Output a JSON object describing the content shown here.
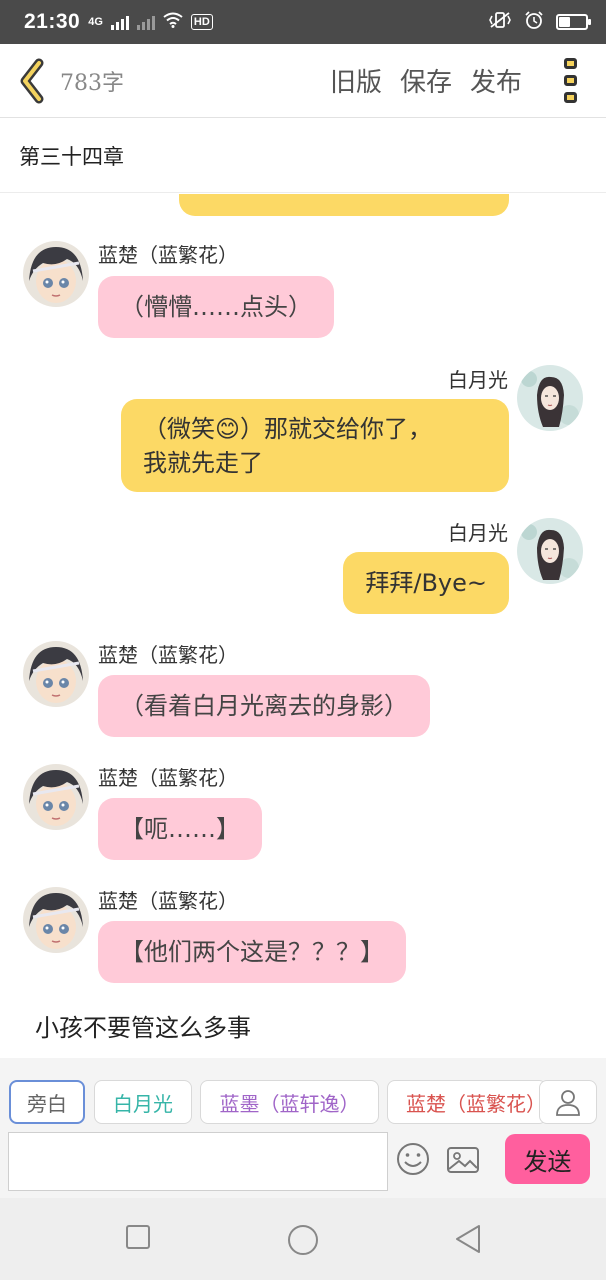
{
  "status": {
    "time": "21:30",
    "network": "4G",
    "hd": "HD"
  },
  "toolbar": {
    "word_count": "783字",
    "old_version": "旧版",
    "save": "保存",
    "publish": "发布"
  },
  "chapter": {
    "title": "第三十四章"
  },
  "messages": [
    {
      "speaker": "蓝楚（蓝繁花）",
      "text": "（懵懵……点头）"
    },
    {
      "speaker": "白月光",
      "text_line1": "（微笑😊）那就交给你了，",
      "text_line2": "我就先走了"
    },
    {
      "speaker": "白月光",
      "text": "拜拜/Bye~"
    },
    {
      "speaker": "蓝楚（蓝繁花）",
      "text": "（看着白月光离去的身影）"
    },
    {
      "speaker": "蓝楚（蓝繁花）",
      "text": "【呃……】"
    },
    {
      "speaker": "蓝楚（蓝繁花）",
      "text": "【他们两个这是？？？】"
    }
  ],
  "narration": "小孩不要管这么多事",
  "roles": [
    "旁白",
    "白月光",
    "蓝墨（蓝轩逸）",
    "蓝楚（蓝繁花）"
  ],
  "role_colors": [
    "#666666",
    "#36b5a8",
    "#a065c8",
    "#d9534f"
  ],
  "input": {
    "placeholder": ""
  },
  "send_label": "发送",
  "colors": {
    "pink_bubble": "#ffcad8",
    "yellow_bubble": "#fcd965",
    "send": "#ff5f9e"
  }
}
